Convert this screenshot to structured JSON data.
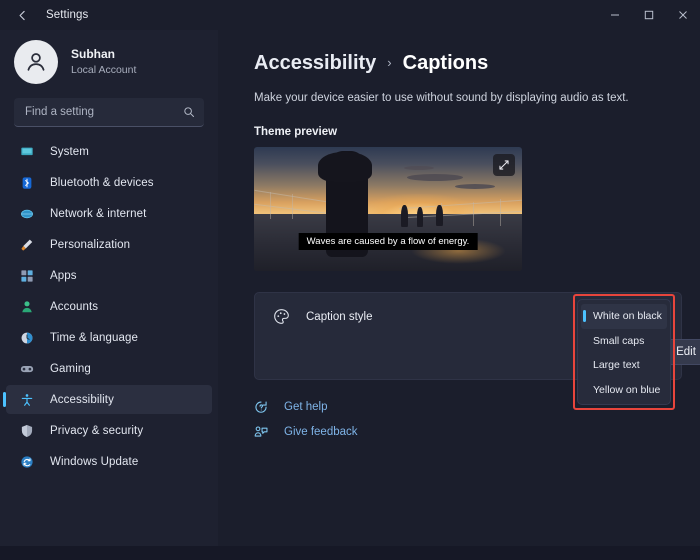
{
  "window": {
    "title": "Settings",
    "back_icon": "back-arrow-icon",
    "controls": [
      {
        "name": "minimize-button",
        "glyph": "minimize-icon"
      },
      {
        "name": "maximize-button",
        "glyph": "maximize-icon"
      },
      {
        "name": "close-button",
        "glyph": "close-icon"
      }
    ]
  },
  "sidebar": {
    "account": {
      "name": "Subhan",
      "subtitle": "Local Account",
      "avatar_icon": "person-avatar-icon"
    },
    "search": {
      "placeholder": "Find a setting",
      "value": "",
      "icon": "search-icon"
    },
    "items": [
      {
        "label": "System",
        "icon": "monitor-icon",
        "selected": false
      },
      {
        "label": "Bluetooth & devices",
        "icon": "bluetooth-icon",
        "selected": false
      },
      {
        "label": "Network & internet",
        "icon": "globe-icon",
        "selected": false
      },
      {
        "label": "Personalization",
        "icon": "paintbrush-icon",
        "selected": false
      },
      {
        "label": "Apps",
        "icon": "apps-grid-icon",
        "selected": false
      },
      {
        "label": "Accounts",
        "icon": "account-person-icon",
        "selected": false
      },
      {
        "label": "Time & language",
        "icon": "clock-icon",
        "selected": false
      },
      {
        "label": "Gaming",
        "icon": "gamepad-icon",
        "selected": false
      },
      {
        "label": "Accessibility",
        "icon": "accessibility-person-icon",
        "selected": true
      },
      {
        "label": "Privacy & security",
        "icon": "shield-icon",
        "selected": false
      },
      {
        "label": "Windows Update",
        "icon": "update-arrows-icon",
        "selected": false
      }
    ]
  },
  "main": {
    "breadcrumb": {
      "parent": "Accessibility",
      "separator": "›",
      "current": "Captions"
    },
    "subtitle": "Make your device easier to use without sound by displaying audio as text.",
    "theme_preview": {
      "label": "Theme preview",
      "caption_text": "Waves are caused by a flow of energy.",
      "expand_icon": "expand-diagonal-icon"
    },
    "caption_style_card": {
      "label": "Caption style",
      "icon": "palette-icon",
      "edit_label": "Edit"
    },
    "links": [
      {
        "label": "Get help",
        "icon": "help-question-icon"
      },
      {
        "label": "Give feedback",
        "icon": "feedback-person-icon"
      }
    ]
  },
  "dropdown": {
    "items": [
      {
        "label": "White on black",
        "selected": true
      },
      {
        "label": "Small caps",
        "selected": false
      },
      {
        "label": "Large text",
        "selected": false
      },
      {
        "label": "Yellow on blue",
        "selected": false
      }
    ]
  },
  "colors": {
    "accent": "#4cc2ff",
    "annotation": "#e8453c",
    "sidebar_bg": "#1e2130",
    "main_bg": "#1b1e2c",
    "card_bg": "#262a3a"
  }
}
